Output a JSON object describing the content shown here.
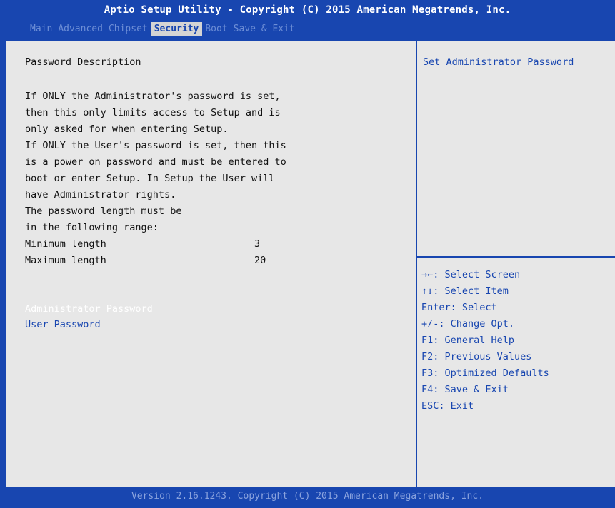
{
  "title": "Aptio Setup Utility - Copyright (C) 2015 American Megatrends, Inc.",
  "tabs": [
    "Main",
    "Advanced",
    "Chipset",
    "Security",
    "Boot",
    "Save & Exit"
  ],
  "active_tab": "Security",
  "left": {
    "heading": "Password Description",
    "description": [
      "If ONLY the Administrator's password is set,",
      "then this only limits access to Setup and is",
      "only asked for when entering Setup.",
      "If ONLY the User's password is set, then this",
      "is a power on password and must be entered to",
      "boot or enter Setup. In Setup the User will",
      "have Administrator rights.",
      "The password length must be",
      "in the following range:"
    ],
    "min_label": "Minimum length",
    "min_value": "3",
    "max_label": "Maximum length",
    "max_value": "20",
    "items": [
      "Administrator Password",
      "User Password"
    ]
  },
  "right": {
    "help_text": "Set Administrator Password",
    "hotkeys": [
      "→←: Select Screen",
      "↑↓: Select Item",
      "Enter: Select",
      "+/-: Change Opt.",
      "F1: General Help",
      "F2: Previous Values",
      "F3: Optimized Defaults",
      "F4: Save & Exit",
      "ESC: Exit"
    ]
  },
  "footer": "Version 2.16.1243. Copyright (C) 2015 American Megatrends, Inc.",
  "colors": {
    "background": "#1846b0",
    "panel": "#e7e7e7",
    "active_tab_bg": "#d4d4d4",
    "selected_text": "#ffffff",
    "link_text": "#1846b0"
  }
}
